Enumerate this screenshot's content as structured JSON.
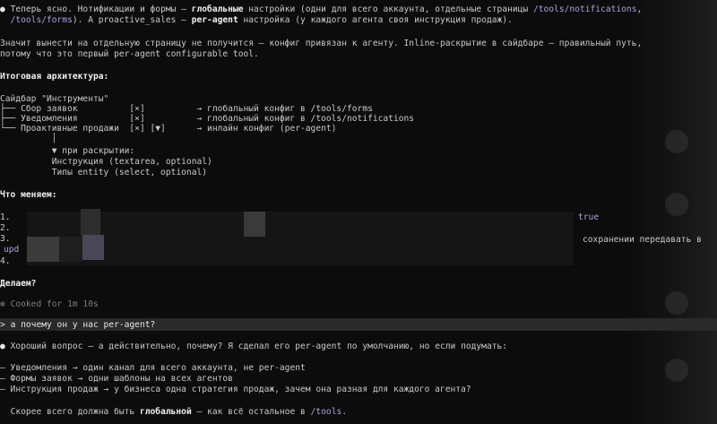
{
  "intro": {
    "l1_a": "Теперь ясно. Нотификации и формы — ",
    "l1_b": "глобальные",
    "l1_c": " настройки (одни для всего аккаунта, отдельные страницы ",
    "l1_link": "/tools/notifications",
    "l1_d": ",",
    "l2_link": "/tools/forms",
    "l2_a": "). А proactive_sales — ",
    "l2_b": "per-agent",
    "l2_c": " настройка (у каждого агента своя инструкция продаж)."
  },
  "para2": {
    "l1": "Значит вынести на отдельную страницу не получится — конфиг привязан к агенту. Inline-раскрытие в сайдбаре — правильный путь,",
    "l2": "потому что это первый per-agent configurable tool."
  },
  "architecture": {
    "heading": "Итоговая архитектура:",
    "tree": [
      "Сайдбар \"Инструменты\"",
      "├── Сбор заявок          [×]          → глобальный конфиг в /tools/forms",
      "├── Уведомления          [×]          → глобальный конфиг в /tools/notifications",
      "└── Проактивные продажи  [×] [▼]      → инлайн конфиг (per-agent)",
      "          │",
      "          ▼ при раскрытии:",
      "          Инструкция (textarea, optional)",
      "          Типы entity (select, optional)"
    ]
  },
  "changes": {
    "heading": "Что меняем:",
    "items": [
      "1.",
      "2.",
      "3.",
      "4."
    ],
    "frag_true": "true",
    "frag_save": "сохранении передавать в",
    "frag_upd": "upd"
  },
  "question": "Делаем?",
  "cooked": "Cooked for 1m 10s",
  "user_msg": "а почему он у нас per-agent?",
  "answer": {
    "l1": "Хороший вопрос — а действительно, почему? Я сделал его per-agent по умолчанию, но если подумать:",
    "items": [
      "— Уведомления → один канал для всего аккаунта, не per-agent",
      "— Формы заявок → одни шаблоны на всех агентов",
      "— Инструкция продаж → у бизнеса одна стратегия продаж, зачем она разная для каждого агента?"
    ],
    "last_a": "Скорее всего должна быть ",
    "last_b": "глобальной",
    "last_c": " — как всё остальное в ",
    "last_link": "/tools",
    "last_d": "."
  }
}
